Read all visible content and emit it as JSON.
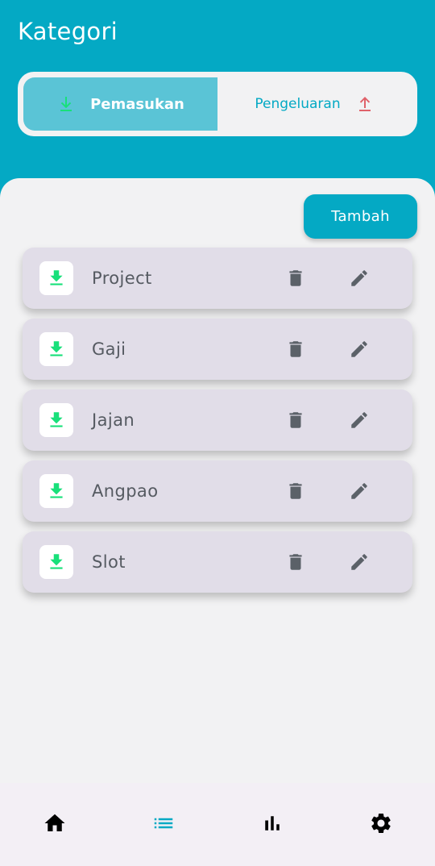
{
  "app": {
    "title": "Kategori"
  },
  "toggle": {
    "income_label": "Pemasukan",
    "expense_label": "Pengeluaran",
    "selected": "income"
  },
  "actions": {
    "add_label": "Tambah"
  },
  "categories": [
    {
      "name": "Project",
      "icon": "download-icon"
    },
    {
      "name": "Gaji",
      "icon": "download-icon"
    },
    {
      "name": "Jajan",
      "icon": "download-icon"
    },
    {
      "name": "Angpao",
      "icon": "download-icon"
    },
    {
      "name": "Slot",
      "icon": "download-icon"
    }
  ],
  "nav": [
    {
      "id": "home",
      "icon": "home-icon",
      "active": false
    },
    {
      "id": "categories",
      "icon": "list-icon",
      "active": true
    },
    {
      "id": "stats",
      "icon": "bar-chart-icon",
      "active": false
    },
    {
      "id": "settings",
      "icon": "gear-icon",
      "active": false
    }
  ],
  "colors": {
    "primary": "#04a9c4",
    "selected_segment": "#5ac4d6",
    "income_green": "#18e07a",
    "expense_red": "#e0626a",
    "item_bg": "#e1dde8",
    "item_text": "#555a61",
    "icon_gray": "#5b6168"
  }
}
